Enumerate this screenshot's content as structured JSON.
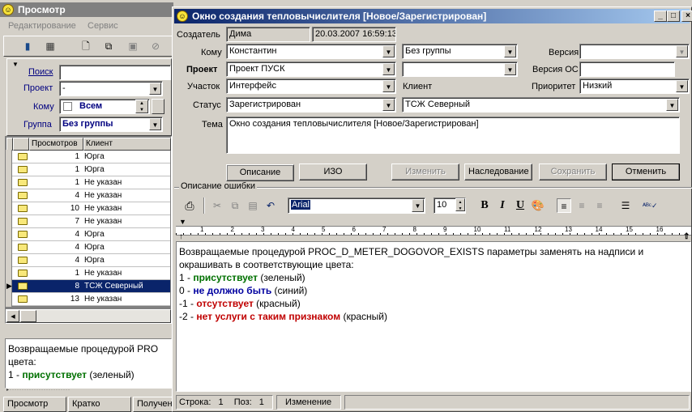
{
  "left_window": {
    "title": "Просмотр",
    "menu": [
      "Редактирование",
      "Сервис"
    ],
    "filters": {
      "search_label": "Поиск",
      "search_value": "",
      "project_label": "Проект",
      "project_value": "-",
      "to_label": "Кому",
      "to_value": "Всем",
      "group_label": "Группа",
      "group_value": "Без группы"
    },
    "columns": [
      "Просмотров",
      "Клиент"
    ],
    "rows": [
      {
        "views": "1",
        "client": "Юрга"
      },
      {
        "views": "1",
        "client": "Юрга"
      },
      {
        "views": "1",
        "client": "Не указан"
      },
      {
        "views": "4",
        "client": "Не указан"
      },
      {
        "views": "10",
        "client": "Не указан"
      },
      {
        "views": "7",
        "client": "Не указан"
      },
      {
        "views": "4",
        "client": "Юрга"
      },
      {
        "views": "4",
        "client": "Юрга"
      },
      {
        "views": "4",
        "client": "Юрга"
      },
      {
        "views": "1",
        "client": "Не указан"
      },
      {
        "views": "8",
        "client": "ТСЖ Северный"
      },
      {
        "views": "13",
        "client": "Не указан"
      }
    ],
    "selected_row": 10,
    "preview": {
      "line1": "Возвращаемые процедурой PRO",
      "line2": "цвета:",
      "line3_num": "1 - ",
      "line3_bold": "присутствует",
      "line3_rest": " (зеленый)"
    },
    "tabs": [
      "Просмотр",
      "Кратко",
      "Получен"
    ]
  },
  "dialog": {
    "title": "Окно создания тепловычислителя [Новое/Зарегистрирован]",
    "creator_label": "Создатель",
    "creator_value": "Дима",
    "date_value": "20.03.2007 16:59:13",
    "to_label": "Кому",
    "to_value": "Константин",
    "group_value": "Без группы",
    "version_label": "Версия",
    "version_value": "",
    "project_label": "Проект",
    "project_value": "Проект ПУСК",
    "project2_value": "",
    "os_version_label": "Версия ОС",
    "os_version_value": "",
    "area_label": "Участок",
    "area_value": "Интерфейс",
    "client_label": "Клиент",
    "priority_label": "Приоритет",
    "priority_value": "Низкий",
    "status_label": "Статус",
    "status_value": "Зарегистрирован",
    "client_value": "ТСЖ Северный",
    "subject_label": "Тема",
    "subject_value": "Окно создания тепловычислителя [Новое/Зарегистрирован]",
    "buttons": {
      "description": "Описание",
      "izo": "ИЗО",
      "change": "Изменить",
      "inherit": "Наследование",
      "save": "Сохранить",
      "cancel": "Отменить"
    },
    "group_box_label": "Описание ошибки",
    "editor_toolbar": {
      "font": "Arial",
      "size": "10"
    },
    "ruler_marks": [
      "1",
      "2",
      "3",
      "4",
      "5",
      "6",
      "7",
      "8",
      "9",
      "10",
      "11",
      "12",
      "13",
      "14",
      "15",
      "16"
    ],
    "body": {
      "line1": "Возвращаемые процедурой PROC_D_METER_DOGOVOR_EXISTS параметры заменять на надписи и",
      "line2": "окрашивать в соответствующие цвета:",
      "l3_num": "1 - ",
      "l3_bold": "присутствует",
      "l3_rest": " (зеленый)",
      "l4_num": "0 - ",
      "l4_bold": "не должно быть",
      "l4_rest": " (синий)",
      "l5_num": "-1 - ",
      "l5_bold": "отсутствует",
      "l5_rest": " (красный)",
      "l6_num": "-2 - ",
      "l6_bold": "нет услуги с таким признаком",
      "l6_rest": " (красный)"
    },
    "statusbar": {
      "row_label": "Строка:",
      "row_value": "1",
      "pos_label": "Поз:",
      "pos_value": "1",
      "state": "Изменение"
    }
  },
  "colors": {
    "title_active_start": "#0a246a",
    "title_active_end": "#a6caf0",
    "title_inactive": "#808080",
    "face": "#d4d0c8"
  }
}
